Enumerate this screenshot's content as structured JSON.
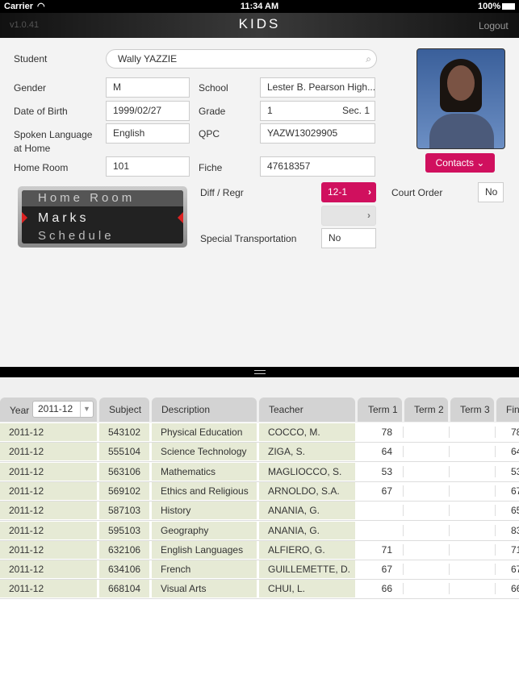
{
  "status": {
    "carrier": "Carrier",
    "time": "11:34 AM",
    "battery": "100%"
  },
  "nav": {
    "version": "v1.0.41",
    "title": "KIDS",
    "logout": "Logout"
  },
  "form": {
    "student_label": "Student",
    "student": "Wally YAZZIE",
    "gender_label": "Gender",
    "gender": "M",
    "school_label": "School",
    "school": "Lester B. Pearson High...",
    "dob_label": "Date of Birth",
    "dob": "1999/02/27",
    "grade_label": "Grade",
    "grade": "1",
    "section": "Sec. 1",
    "lang_label": "Spoken Language at Home",
    "lang": "English",
    "qpc_label": "QPC",
    "qpc": "YAZW13029905",
    "homeroom_label": "Home Room",
    "homeroom": "101",
    "fiche_label": "Fiche",
    "fiche": "47618357",
    "diff_label": "Diff / Regr",
    "diff": "12-1",
    "diff2": "",
    "court_label": "Court Order",
    "court": "No",
    "transport_label": "Special Transportation",
    "transport": "No",
    "contacts": "Contacts"
  },
  "picker": {
    "prev": "Home Room",
    "current": "Marks",
    "next": "Schedule"
  },
  "colors": {
    "accent": "#d0105e",
    "row_bg": "#e6ead5"
  },
  "table": {
    "year_label": "Year",
    "year": "2011-12",
    "headers": [
      "Subject",
      "Description",
      "Teacher",
      "Term 1",
      "Term 2",
      "Term 3",
      "Final"
    ],
    "rows": [
      [
        "2011-12",
        "543102",
        "Physical Education",
        "COCCO, M.",
        "78",
        "",
        "",
        "78"
      ],
      [
        "2011-12",
        "555104",
        "Science Technology",
        "ZIGA, S.",
        "64",
        "",
        "",
        "64"
      ],
      [
        "2011-12",
        "563106",
        "Mathematics",
        "MAGLIOCCO, S.",
        "53",
        "",
        "",
        "53"
      ],
      [
        "2011-12",
        "569102",
        "Ethics and Religious",
        "ARNOLDO, S.A.",
        "67",
        "",
        "",
        "67"
      ],
      [
        "2011-12",
        "587103",
        "History",
        "ANANIA, G.",
        "",
        "",
        "",
        "65"
      ],
      [
        "2011-12",
        "595103",
        "Geography",
        "ANANIA, G.",
        "",
        "",
        "",
        "83"
      ],
      [
        "2011-12",
        "632106",
        "English Languages",
        "ALFIERO, G.",
        "71",
        "",
        "",
        "71"
      ],
      [
        "2011-12",
        "634106",
        "French",
        "GUILLEMETTE, D.",
        "67",
        "",
        "",
        "67"
      ],
      [
        "2011-12",
        "668104",
        "Visual Arts",
        "CHUI, L.",
        "66",
        "",
        "",
        "66"
      ]
    ]
  }
}
